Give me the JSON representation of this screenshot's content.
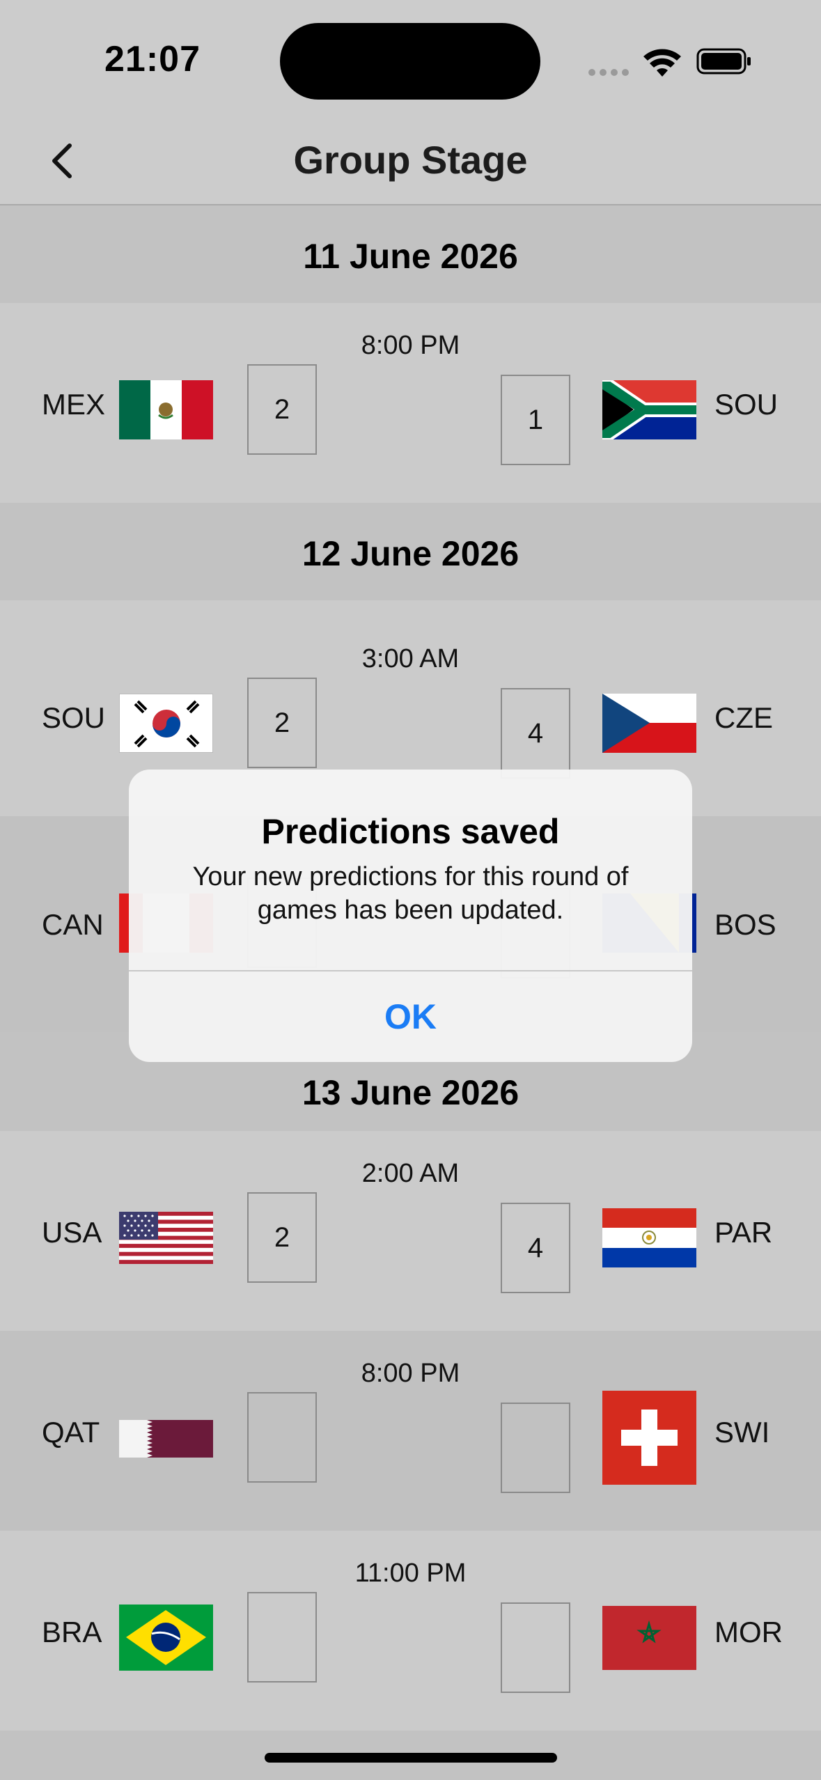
{
  "status": {
    "time": "21:07"
  },
  "nav": {
    "title": "Group Stage",
    "back_icon": "chevron-left-icon"
  },
  "sections": [
    {
      "date": "11 June 2026",
      "matches": [
        {
          "time": "8:00 PM",
          "home": "MEX",
          "home_flag": "mexico-flag",
          "home_score": "2",
          "away": "SOU",
          "away_flag": "south-africa-flag",
          "away_score": "1"
        }
      ]
    },
    {
      "date": "12 June 2026",
      "matches": [
        {
          "time": "3:00 AM",
          "home": "SOU",
          "home_flag": "south-korea-flag",
          "home_score": "2",
          "away": "CZE",
          "away_flag": "czech-flag",
          "away_score": "4"
        },
        {
          "time": "",
          "home": "CAN",
          "home_flag": "canada-flag",
          "home_score": "",
          "away": "BOS",
          "away_flag": "bosnia-flag",
          "away_score": ""
        }
      ]
    },
    {
      "date": "13 June 2026",
      "matches": [
        {
          "time": "2:00 AM",
          "home": "USA",
          "home_flag": "usa-flag",
          "home_score": "2",
          "away": "PAR",
          "away_flag": "paraguay-flag",
          "away_score": "4"
        },
        {
          "time": "8:00 PM",
          "home": "QAT",
          "home_flag": "qatar-flag",
          "home_score": "",
          "away": "SWI",
          "away_flag": "switzerland-flag",
          "away_score": ""
        },
        {
          "time": "11:00 PM",
          "home": "BRA",
          "home_flag": "brazil-flag",
          "home_score": "",
          "away": "MOR",
          "away_flag": "morocco-flag",
          "away_score": ""
        }
      ]
    }
  ],
  "alert": {
    "title": "Predictions saved",
    "message": "Your new predictions for this round of games has been updated.",
    "ok_label": "OK"
  },
  "colors": {
    "accent": "#1A7CF5",
    "background": "#CBCBCB",
    "header_bg": "#C2C2C2"
  }
}
